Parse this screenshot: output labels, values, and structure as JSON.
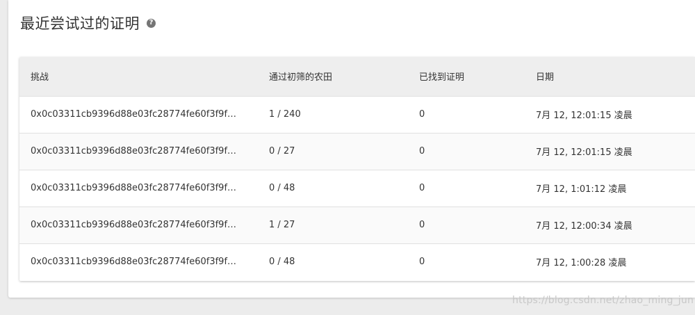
{
  "panel": {
    "title": "最近尝试过的证明",
    "help_icon": "?"
  },
  "table": {
    "headers": [
      "挑战",
      "通过初筛的农田",
      "已找到证明",
      "日期"
    ],
    "rows": [
      [
        "0x0c03311cb9396d88e03fc28774fe60f3f9fc...",
        "1 / 240",
        "0",
        "7月 12, 12:01:15 凌晨"
      ],
      [
        "0x0c03311cb9396d88e03fc28774fe60f3f9fc...",
        "0 / 27",
        "0",
        "7月 12, 12:01:15 凌晨"
      ],
      [
        "0x0c03311cb9396d88e03fc28774fe60f3f9fc...",
        "0 / 48",
        "0",
        "7月 12, 1:01:12 凌晨"
      ],
      [
        "0x0c03311cb9396d88e03fc28774fe60f3f9fc...",
        "1 / 27",
        "0",
        "7月 12, 12:00:34 凌晨"
      ],
      [
        "0x0c03311cb9396d88e03fc28774fe60f3f9fc...",
        "0 / 48",
        "0",
        "7月 12, 1:00:28 凌晨"
      ]
    ]
  },
  "watermark": "https://blog.csdn.net/zhao_ming_jun"
}
